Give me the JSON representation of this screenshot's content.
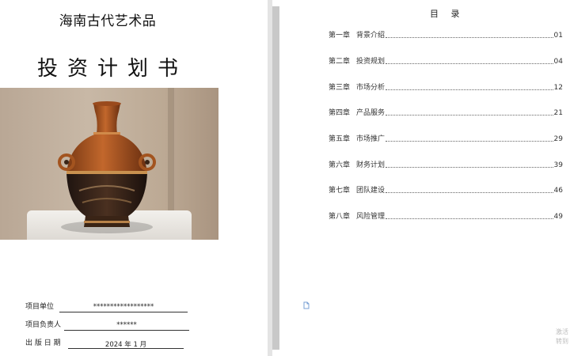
{
  "cover": {
    "company": "海南古代艺术品",
    "title": "投资计划书",
    "info": [
      {
        "label": "项目单位",
        "value": "******************"
      },
      {
        "label": "项目负责人",
        "value": "******"
      },
      {
        "label": "出 版 日 期",
        "value": "2024 年 1 月"
      }
    ]
  },
  "toc": {
    "heading": "目 录",
    "items": [
      {
        "chapter": "第一章",
        "name": "背景介绍",
        "page": "01"
      },
      {
        "chapter": "第二章",
        "name": "投资规划",
        "page": "04"
      },
      {
        "chapter": "第三章",
        "name": "市场分析",
        "page": "12"
      },
      {
        "chapter": "第四章",
        "name": "产品服务",
        "page": "21"
      },
      {
        "chapter": "第五章",
        "name": "市场推广",
        "page": "29"
      },
      {
        "chapter": "第六章",
        "name": "财务计划",
        "page": "39"
      },
      {
        "chapter": "第七章",
        "name": "团队建设",
        "page": "46"
      },
      {
        "chapter": "第八章",
        "name": "风险管理",
        "page": "49"
      }
    ]
  },
  "watermark": {
    "line1": "激活",
    "line2": "转到"
  },
  "icons": {
    "vase": "vase-photo",
    "file": "file-icon"
  }
}
